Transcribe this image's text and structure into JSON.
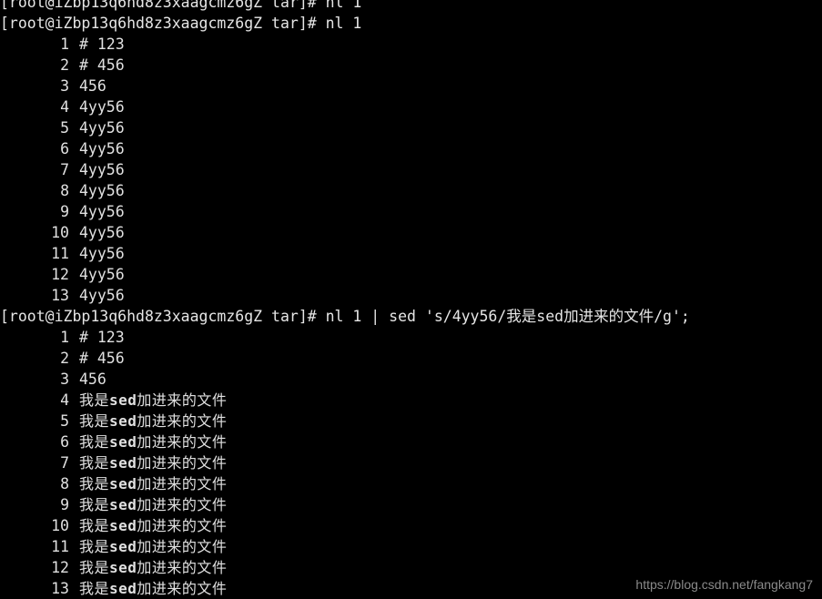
{
  "terminal": {
    "background_color": "#000000",
    "text_color": "#d8d8d8",
    "prompt": "[root@iZbp13q6hd8z3xaagcmz6gZ tar]#",
    "blocks": [
      {
        "command_line": "[root@iZbp13q6hd8z3xaagcmz6gZ tar]# nl 1",
        "command": "nl 1",
        "rows": [
          {
            "n": "1",
            "text": "# 123"
          },
          {
            "n": "2",
            "text": "# 456"
          },
          {
            "n": "3",
            "text": "456"
          },
          {
            "n": "4",
            "text": "4yy56"
          },
          {
            "n": "5",
            "text": "4yy56"
          },
          {
            "n": "6",
            "text": "4yy56"
          },
          {
            "n": "7",
            "text": "4yy56"
          },
          {
            "n": "8",
            "text": "4yy56"
          },
          {
            "n": "9",
            "text": "4yy56"
          },
          {
            "n": "10",
            "text": "4yy56"
          },
          {
            "n": "11",
            "text": "4yy56"
          },
          {
            "n": "12",
            "text": "4yy56"
          },
          {
            "n": "13",
            "text": "4yy56"
          }
        ]
      },
      {
        "command_line": "[root@iZbp13q6hd8z3xaagcmz6gZ tar]# nl 1 | sed 's/4yy56/我是sed加进来的文件/g';",
        "command": "nl 1 | sed 's/4yy56/我是sed加进来的文件/g';",
        "replacement_text": "我是sed加进来的文件",
        "rows": [
          {
            "n": "1",
            "text": "# 123",
            "cjk": false
          },
          {
            "n": "2",
            "text": "# 456",
            "cjk": false
          },
          {
            "n": "3",
            "text": "456",
            "cjk": false
          },
          {
            "n": "4",
            "text": "我是sed加进来的文件",
            "cjk": true
          },
          {
            "n": "5",
            "text": "我是sed加进来的文件",
            "cjk": true
          },
          {
            "n": "6",
            "text": "我是sed加进来的文件",
            "cjk": true
          },
          {
            "n": "7",
            "text": "我是sed加进来的文件",
            "cjk": true
          },
          {
            "n": "8",
            "text": "我是sed加进来的文件",
            "cjk": true
          },
          {
            "n": "9",
            "text": "我是sed加进来的文件",
            "cjk": true
          },
          {
            "n": "10",
            "text": "我是sed加进来的文件",
            "cjk": true
          },
          {
            "n": "11",
            "text": "我是sed加进来的文件",
            "cjk": true
          },
          {
            "n": "12",
            "text": "我是sed加进来的文件",
            "cjk": true
          },
          {
            "n": "13",
            "text": "我是sed加进来的文件",
            "cjk": true
          }
        ]
      }
    ]
  },
  "watermark": {
    "text": "https://blog.csdn.net/fangkang7"
  }
}
